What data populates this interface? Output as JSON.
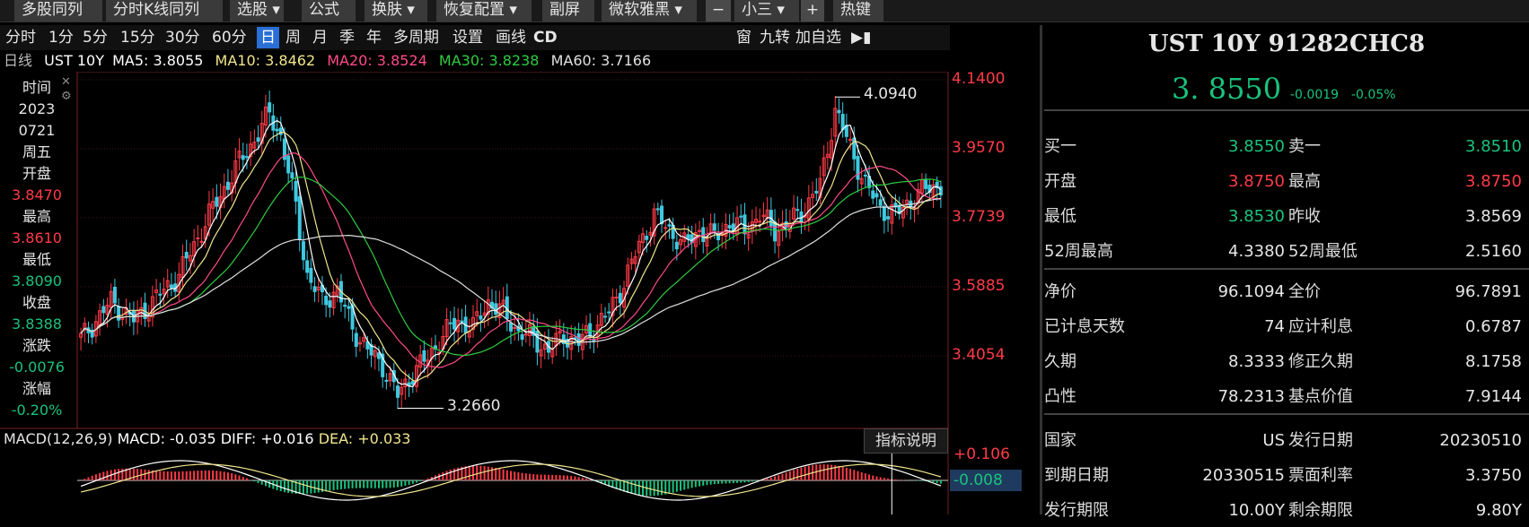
{
  "toolbar": {
    "multi_stock": "多股同列",
    "intraday_k": "分时K线同列",
    "pick_stock": "选股",
    "formula": "公式",
    "skin": "换肤",
    "restore": "恢复配置",
    "sub_screen": "副屏",
    "font_name": "微软雅黑",
    "minus": "−",
    "font_size": "小三",
    "plus": "+",
    "hotkey": "热键"
  },
  "periods": [
    "分时",
    "1分",
    "5分",
    "15分",
    "30分",
    "60分",
    "日",
    "周",
    "月",
    "季",
    "年",
    "多周期",
    "设置",
    "画线",
    "CD"
  ],
  "active_period": "日",
  "right_tools": [
    "窗",
    "九转",
    "加自选"
  ],
  "ma_bar": {
    "period_label": "日线",
    "name": "UST 10Y",
    "ma5": "MA5: 3.8055",
    "ma10": "MA10: 3.8462",
    "ma20": "MA20: 3.8524",
    "ma30": "MA30: 3.8238",
    "ma60": "MA60: 3.7166"
  },
  "info_panel": {
    "time_label": "时间",
    "year": "2023",
    "date": "0721",
    "weekday": "周五",
    "open_label": "开盘",
    "open": "3.8470",
    "high_label": "最高",
    "high": "3.8610",
    "low_label": "最低",
    "low": "3.8090",
    "close_label": "收盘",
    "close": "3.8388",
    "change_label": "涨跌",
    "change": "-0.0076",
    "pct_label": "涨幅",
    "pct": "-0.20%"
  },
  "price_axis": [
    "4.1400",
    "3.9570",
    "3.7739",
    "3.5885",
    "3.4054"
  ],
  "annotations": {
    "max": "4.0940",
    "min": "3.2660"
  },
  "macd": {
    "title": "MACD(12,26,9)",
    "macd": "MACD: -0.035",
    "diff": "DIFF: +0.016",
    "dea": "DEA: +0.033",
    "button": "指标说明",
    "axis_top": "+0.106",
    "axis_cur": "-0.008"
  },
  "quote": {
    "title": "UST 10Y  91282CHC8",
    "price": "3. 8550",
    "change": "-0.0019",
    "pct": "-0.05%",
    "rows": [
      [
        "买一",
        "3.8550",
        "卖一",
        "3.8510"
      ],
      [
        "开盘",
        "3.8750",
        "最高",
        "3.8750"
      ],
      [
        "最低",
        "3.8530",
        "昨收",
        "3.8569"
      ],
      [
        "52周最高",
        "4.3380",
        "52周最低",
        "2.5160"
      ],
      [
        "净价",
        "96.1094",
        "全价",
        "96.7891"
      ],
      [
        "已计息天数",
        "74",
        "应计利息",
        "0.6787"
      ],
      [
        "久期",
        "8.3333",
        "修正久期",
        "8.1758"
      ],
      [
        "凸性",
        "78.2313",
        "基点价值",
        "7.9144"
      ],
      [
        "国家",
        "US",
        "发行日期",
        "20230510"
      ],
      [
        "到期日期",
        "20330515",
        "票面利率",
        "3.3750"
      ],
      [
        "发行期限",
        "10.00Y",
        "剩余期限",
        "9.80Y"
      ]
    ]
  },
  "colors": {
    "up": "#ff3b47",
    "down": "#3ec9e0",
    "ma5": "#ffffff",
    "ma10": "#f0e68c",
    "ma20": "#ff4a8a",
    "ma30": "#2ecc40",
    "ma60": "#e0e0e0"
  }
}
